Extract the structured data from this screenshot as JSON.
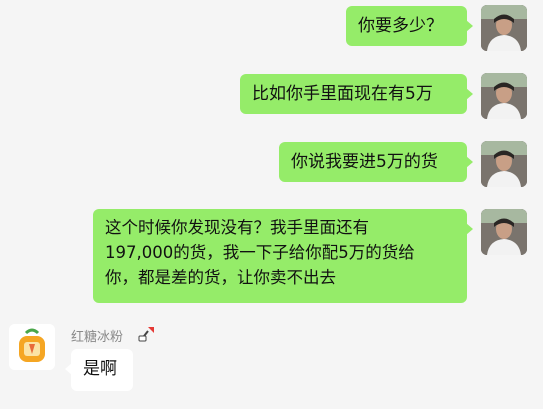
{
  "messages": [
    {
      "text": "你要多少？"
    },
    {
      "text": "比如你手里面现在有5万"
    },
    {
      "text": "你说我要进5万的货"
    },
    {
      "lines": [
        "这个时候你发现没有？我手里面还有",
        "197,000的货，我一下子给你配5万的货给",
        "你，都是差的货，让你卖不出去"
      ]
    },
    {
      "sender": "红糖冰粉",
      "text": "是啊"
    }
  ],
  "colors": {
    "self_bubble": "#95ec69",
    "other_bubble": "#ffffff",
    "background": "#f5f5f5"
  }
}
